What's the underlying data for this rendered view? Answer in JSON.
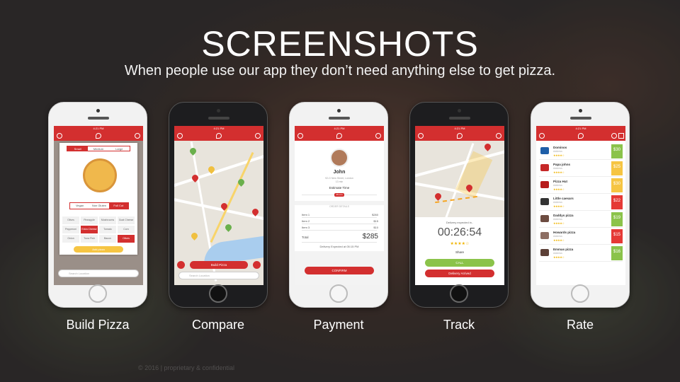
{
  "slide": {
    "title": "SCREENSHOTS",
    "subtitle": "When people use our app they don’t need anything else to get pizza.",
    "footer": "© 2016 | proprietary & confidential"
  },
  "phones": [
    {
      "caption": "Build Pizza"
    },
    {
      "caption": "Compare"
    },
    {
      "caption": "Payment"
    },
    {
      "caption": "Track"
    },
    {
      "caption": "Rate"
    }
  ],
  "status_time": "4:21 PM",
  "status_battery": "100%",
  "build": {
    "sizes": [
      "Small",
      "Medium",
      "Large"
    ],
    "crusts": [
      "Vegan",
      "Non Gluten",
      "Full Cut"
    ],
    "toppings": [
      "Olives",
      "Pineapple",
      "Mushrooms",
      "Goat Cheese",
      "Pepperoni",
      "Extra Cheese",
      "Tomato",
      "Corn",
      "Onion",
      "Tuna Fish",
      "Bacon",
      "Olives"
    ],
    "add_label": "Add pizza",
    "search_placeholder": "Search Location"
  },
  "compare": {
    "build_label": "Build Pizza",
    "search_placeholder": "Search Location"
  },
  "payment": {
    "name": "John",
    "address": "92-G New Street, London",
    "distance": "13 min",
    "estimate_label": "Estimate Time",
    "estimate_value": "45 min",
    "order_details_label": "ORDER DETAILS",
    "items": [
      {
        "label": "Item 1",
        "price": "$260"
      },
      {
        "label": "Item 2",
        "price": "$15"
      },
      {
        "label": "Item 3",
        "price": "$10"
      }
    ],
    "total_label": "Total",
    "total_value": "$285",
    "delivery_note": "Delivery Expected at 05:15 PM",
    "confirm_label": "CONFIRM"
  },
  "track": {
    "expected_label": "Delivery expected in..",
    "timer": "00:26:54",
    "stars": "★★★★☆",
    "share_label": "Share",
    "call_label": "CALL",
    "arrived_label": "Delivery Arrived"
  },
  "rate": {
    "rows": [
      {
        "name": "Dominos",
        "sub": "Address",
        "stars": "★★★★☆",
        "price": "$30",
        "color": "#8bc34a",
        "logo": "#1e5fa8"
      },
      {
        "name": "Papa johns",
        "sub": "Address",
        "stars": "★★★★☆",
        "price": "$25",
        "color": "#f6c543",
        "logo": "#c62828"
      },
      {
        "name": "Pizza Hut",
        "sub": "Address",
        "stars": "★★★★☆",
        "price": "$30",
        "color": "#f6c543",
        "logo": "#b71c1c"
      },
      {
        "name": "Little caesars",
        "sub": "Address",
        "stars": "★★★★☆",
        "price": "$22",
        "color": "#e53935",
        "logo": "#333333"
      },
      {
        "name": "Daddys pizza",
        "sub": "Address",
        "stars": "★★★★☆",
        "price": "$19",
        "color": "#8bc34a",
        "logo": "#6d4c41"
      },
      {
        "name": "Howards pizza",
        "sub": "Address",
        "stars": "★★★★☆",
        "price": "$15",
        "color": "#e53935",
        "logo": "#8d6e63"
      },
      {
        "name": "Emmas pizza",
        "sub": "Address",
        "stars": "★★★★☆",
        "price": "$16",
        "color": "#8bc34a",
        "logo": "#5d4037"
      }
    ]
  }
}
